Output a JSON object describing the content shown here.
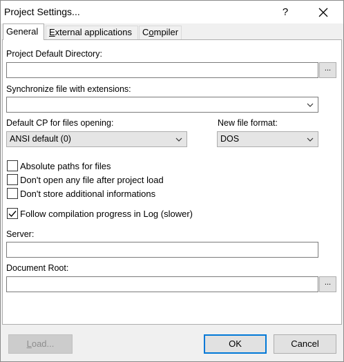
{
  "window": {
    "title": "Project Settings...",
    "help": "?"
  },
  "tabs": [
    {
      "label": "General",
      "active": true
    },
    {
      "label_pre": "E",
      "label_rest": "xternal applications"
    },
    {
      "label_pre": "C",
      "label_u": "o",
      "label_rest": "mpiler"
    }
  ],
  "general": {
    "project_dir_label": "Project Default Directory:",
    "project_dir_value": "",
    "sync_label": "Synchronize file with extensions:",
    "sync_value": "",
    "cp_label": "Default CP for files opening:",
    "cp_value": "ANSI default (0)",
    "format_label": "New file format:",
    "format_value": "DOS",
    "browse": "...",
    "checkboxes": [
      {
        "label": "Absolute paths for files",
        "checked": false
      },
      {
        "label": "Don't open any file after project load",
        "checked": false
      },
      {
        "label": "Don't store additional informations",
        "checked": false
      },
      {
        "label": "Follow compilation progress in Log (slower)",
        "checked": true
      }
    ],
    "server_label": "Server:",
    "server_value": "",
    "docroot_label": "Document Root:",
    "docroot_value": ""
  },
  "buttons": {
    "load": "Load...",
    "load_u": "L",
    "load_rest": "oad...",
    "ok": "OK",
    "cancel": "Cancel"
  },
  "colors": {
    "accent": "#0078d7"
  }
}
